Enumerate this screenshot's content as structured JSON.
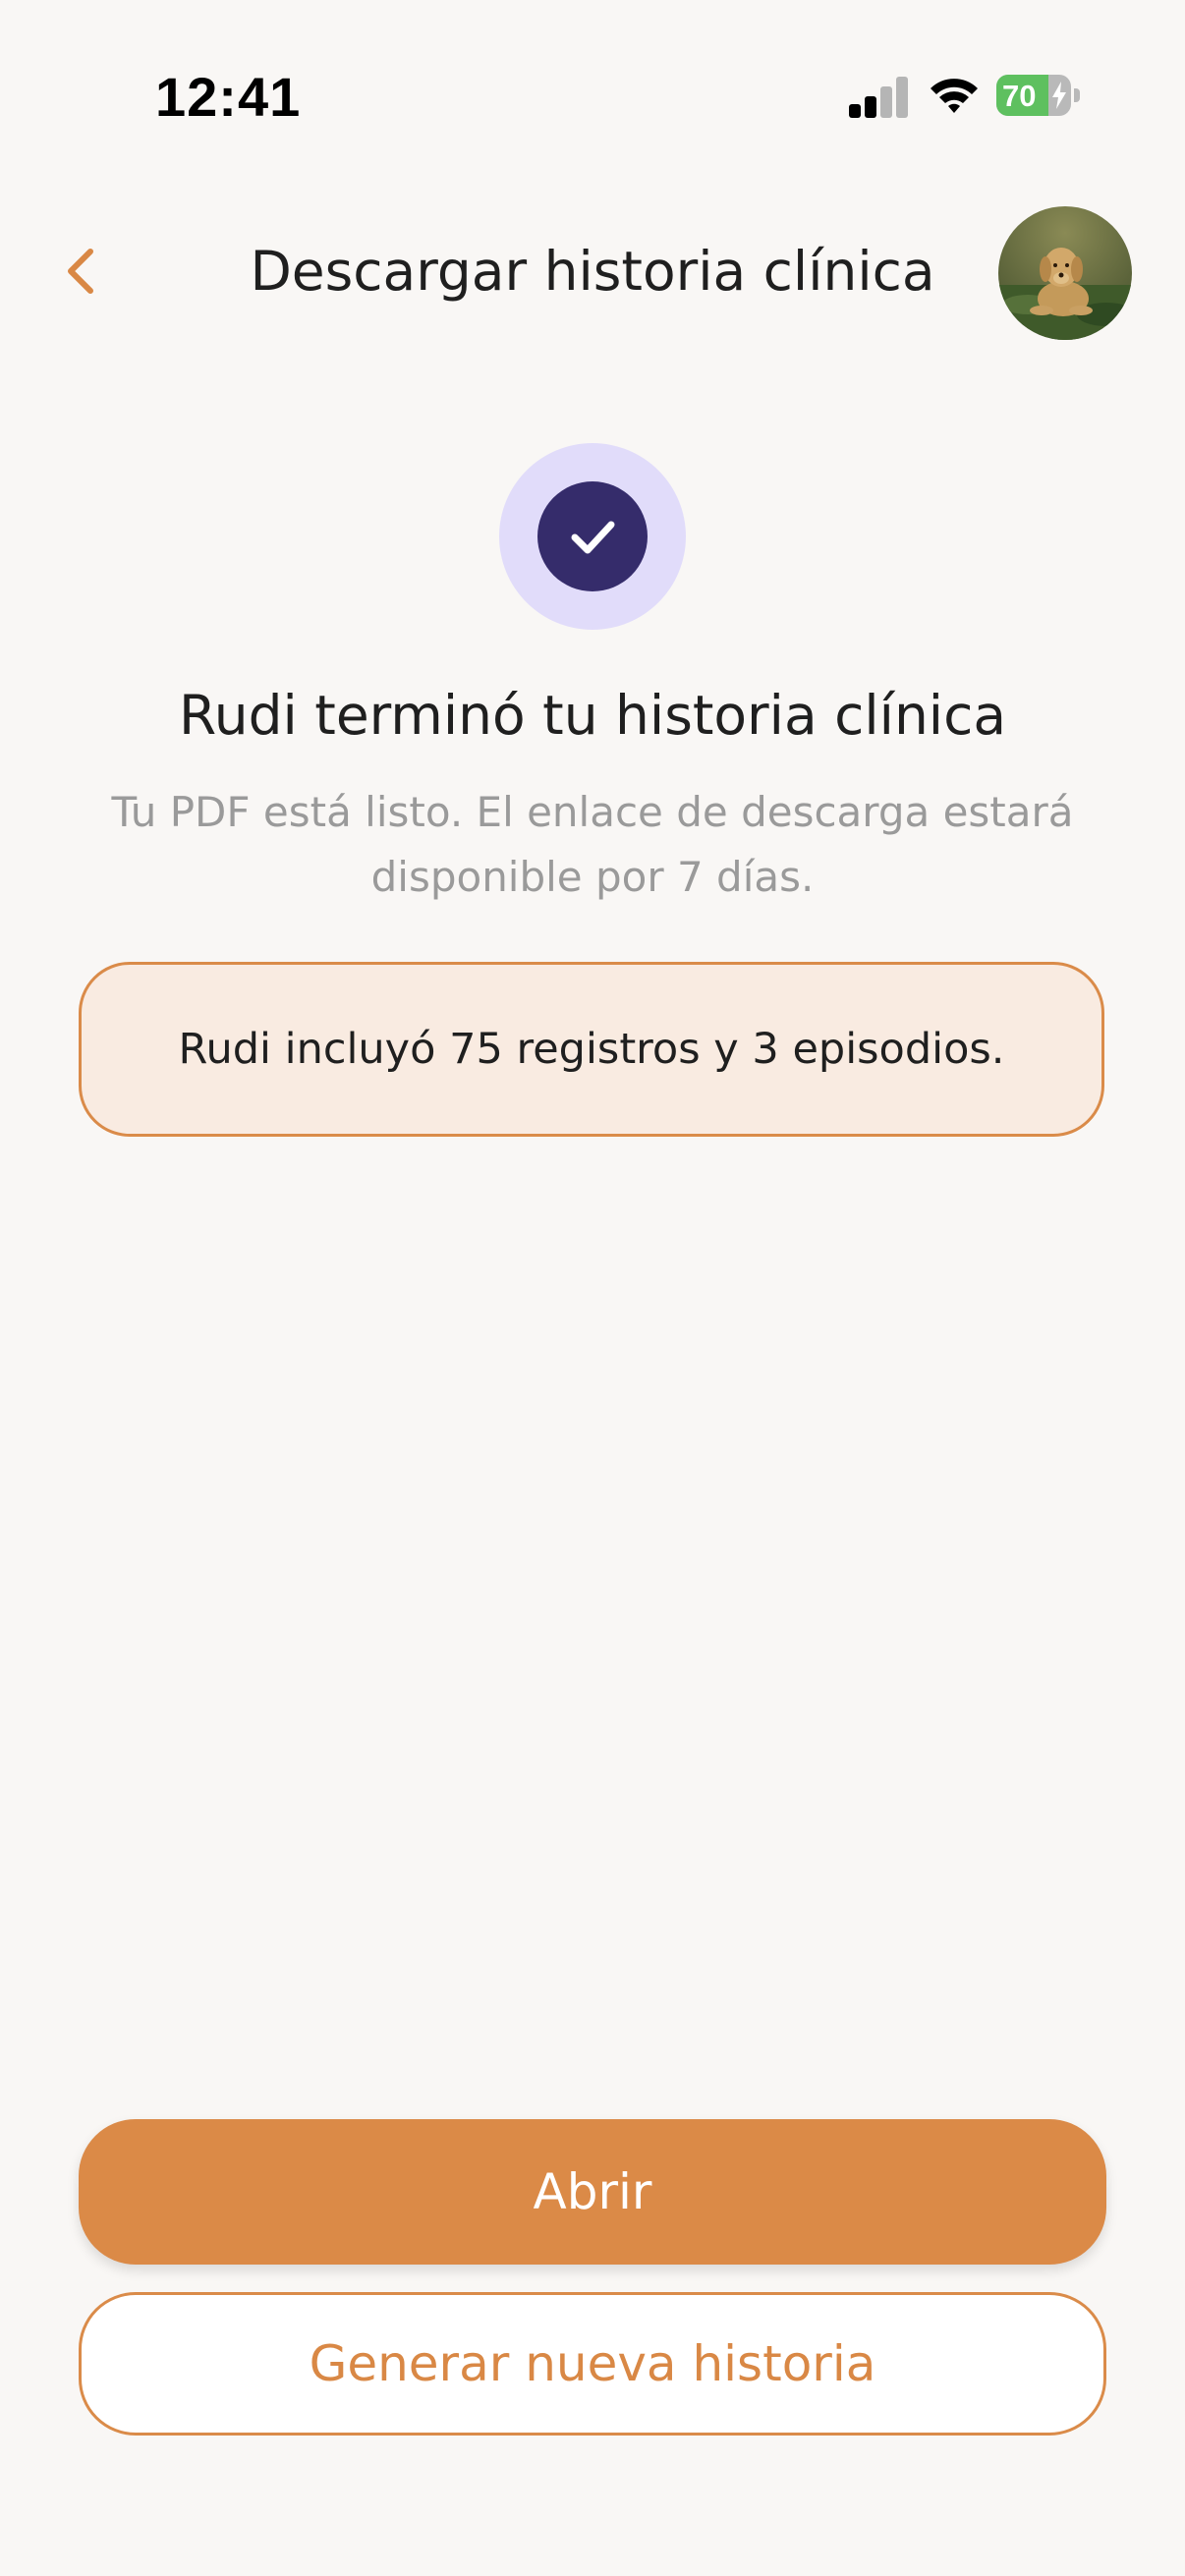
{
  "status_bar": {
    "time": "12:41",
    "battery_level": "70",
    "icons": [
      "signal-icon",
      "wifi-icon",
      "battery-icon",
      "charging-bolt-icon"
    ]
  },
  "header": {
    "title": "Descargar historia clínica",
    "back_icon": "chevron-left-icon",
    "avatar": "pet-avatar-photo"
  },
  "success": {
    "icon": "checkmark-icon",
    "title": "Rudi terminó tu historia clínica",
    "subtitle": "Tu PDF está listo. El enlace de descarga estará disponible por 7 días."
  },
  "summary": {
    "text": "Rudi incluyó 75 registros y 3 episodios."
  },
  "actions": {
    "open_label": "Abrir",
    "new_label": "Generar nueva historia"
  },
  "colors": {
    "background": "#f9f7f5",
    "accent": "#db8a47",
    "success_halo": "#e1dcfa",
    "success_circle": "#352c6b",
    "summary_bg": "#f9ebe1",
    "battery_green": "#5ec05f"
  }
}
